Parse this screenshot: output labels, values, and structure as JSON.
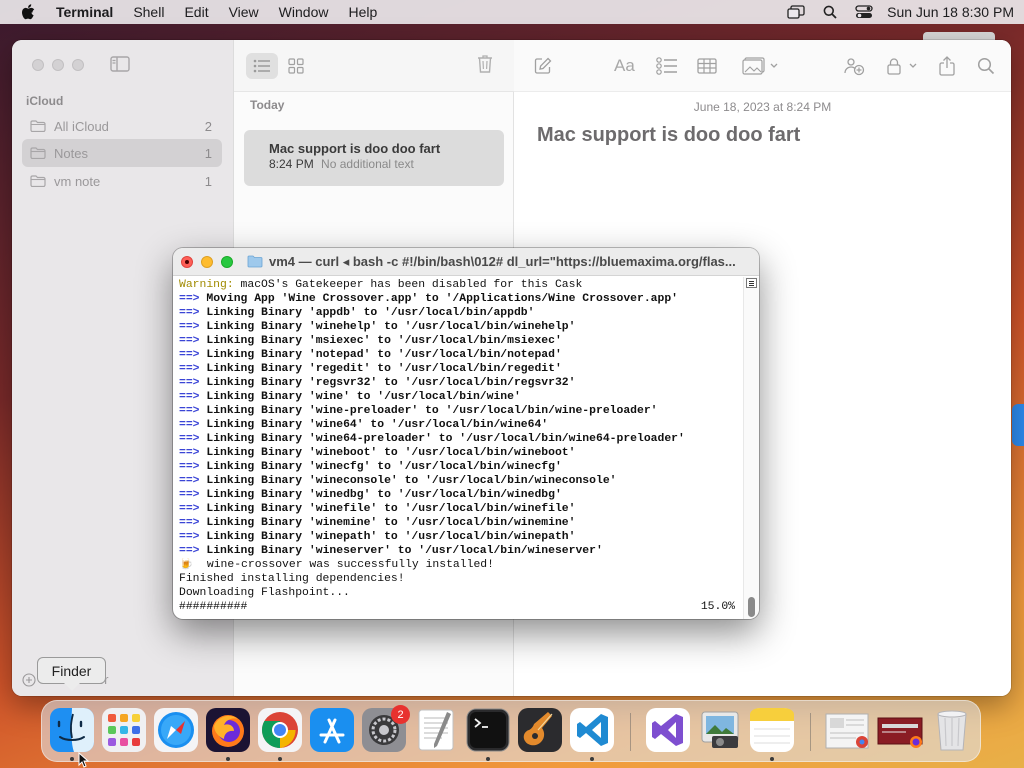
{
  "menubar": {
    "app_name": "Terminal",
    "items": [
      "Shell",
      "Edit",
      "View",
      "Window",
      "Help"
    ],
    "clock": "Sun Jun 18  8:30 PM"
  },
  "notes": {
    "sidebar_heading": "iCloud",
    "folders": [
      {
        "label": "All iCloud",
        "count": "2"
      },
      {
        "label": "Notes",
        "count": "1"
      },
      {
        "label": "vm note",
        "count": "1"
      }
    ],
    "new_folder_label": "New Folder",
    "list_section": "Today",
    "note_card": {
      "title": "Mac support is doo doo fart",
      "time": "8:24 PM",
      "preview": "No additional text"
    },
    "editor": {
      "date": "June 18, 2023 at 8:24 PM",
      "title": "Mac support is doo doo fart"
    }
  },
  "terminal": {
    "title": "vm4 — curl ◂ bash -c #!/bin/bash\\012# dl_url=\"https://bluemaxima.org/flas...",
    "warning_label": "Warning:",
    "warning_text": " macOS's Gatekeeper has been disabled for this Cask",
    "arrow": "==>",
    "arrow_lines": [
      "Moving App 'Wine Crossover.app' to '/Applications/Wine Crossover.app'",
      "Linking Binary 'appdb' to '/usr/local/bin/appdb'",
      "Linking Binary 'winehelp' to '/usr/local/bin/winehelp'",
      "Linking Binary 'msiexec' to '/usr/local/bin/msiexec'",
      "Linking Binary 'notepad' to '/usr/local/bin/notepad'",
      "Linking Binary 'regedit' to '/usr/local/bin/regedit'",
      "Linking Binary 'regsvr32' to '/usr/local/bin/regsvr32'",
      "Linking Binary 'wine' to '/usr/local/bin/wine'",
      "Linking Binary 'wine-preloader' to '/usr/local/bin/wine-preloader'",
      "Linking Binary 'wine64' to '/usr/local/bin/wine64'",
      "Linking Binary 'wine64-preloader' to '/usr/local/bin/wine64-preloader'",
      "Linking Binary 'wineboot' to '/usr/local/bin/wineboot'",
      "Linking Binary 'winecfg' to '/usr/local/bin/winecfg'",
      "Linking Binary 'wineconsole' to '/usr/local/bin/wineconsole'",
      "Linking Binary 'winedbg' to '/usr/local/bin/winedbg'",
      "Linking Binary 'winefile' to '/usr/local/bin/winefile'",
      "Linking Binary 'winemine' to '/usr/local/bin/winemine'",
      "Linking Binary 'winepath' to '/usr/local/bin/winepath'",
      "Linking Binary 'wineserver' to '/usr/local/bin/wineserver'"
    ],
    "beer_emoji": "🍺",
    "success_line": "  wine-crossover was successfully installed!",
    "line_finished": "Finished installing dependencies!",
    "line_downloading": "Downloading Flashpoint...",
    "progress_hashes": "##########",
    "progress_percent": "15.0%"
  },
  "tooltip": "Finder",
  "dock": {
    "apps": [
      "Finder",
      "Launchpad",
      "Safari",
      "Firefox",
      "Google Chrome",
      "App Store",
      "System Settings",
      "TextEdit",
      "Terminal",
      "GarageBand",
      "Visual Studio Code",
      "Visual Studio",
      "Preview",
      "Notes",
      "Downloads",
      "Documents",
      "Trash"
    ],
    "system_settings_badge": "2"
  },
  "colors": {
    "warning": "#a08a00",
    "arrow": "#3a44d6",
    "close": "#fe5f57",
    "minimize": "#febc2e",
    "maximize": "#28c840"
  }
}
